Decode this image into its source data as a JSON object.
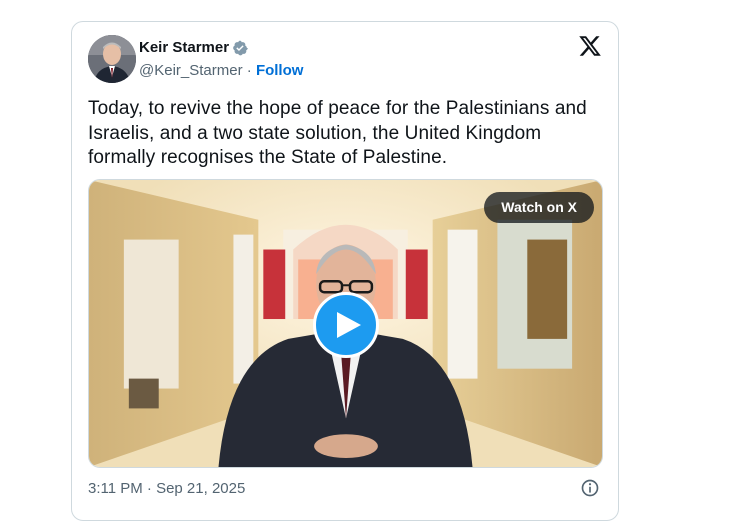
{
  "tweet": {
    "author": {
      "name": "Keir Starmer",
      "handle": "@Keir_Starmer",
      "separator": " · ",
      "follow_label": "Follow",
      "verified": true,
      "avatar_icon": "person-portrait"
    },
    "text": "Today, to revive the hope of peace for the Palestinians and Israelis, and a two state solution, the United Kingdom formally recognises the State of Palestine.",
    "media": {
      "type": "video",
      "watch_label": "Watch on X",
      "play_icon": "play-icon"
    },
    "timestamp": "3:11 PM · Sep 21, 2025",
    "info_icon": "info-icon",
    "platform_icon": "x-logo-icon"
  },
  "colors": {
    "link": "#006fd6",
    "verified": "#829aab",
    "play": "#1d9bf0",
    "text": "#0f1419",
    "muted": "#536471",
    "border": "#cfd9de"
  }
}
